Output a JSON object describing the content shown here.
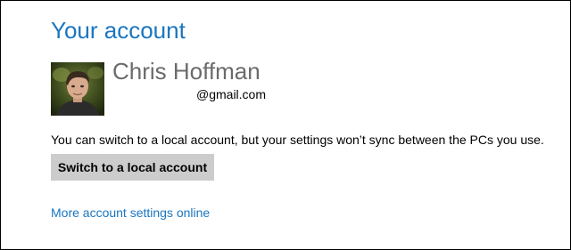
{
  "account": {
    "title": "Your account",
    "user_name": "Chris Hoffman",
    "user_email": "@gmail.com",
    "info_text": "You can switch to a local account, but your settings won’t sync between the PCs you use.",
    "switch_button_label": "Switch to a local account",
    "more_settings_link": "More account settings online"
  },
  "colors": {
    "accent": "#1a76c0",
    "name_gray": "#6b6b6b",
    "button_bg": "#cccccc",
    "text": "#000000",
    "background": "#ffffff"
  },
  "icons": {
    "avatar": "user-profile-photo"
  }
}
